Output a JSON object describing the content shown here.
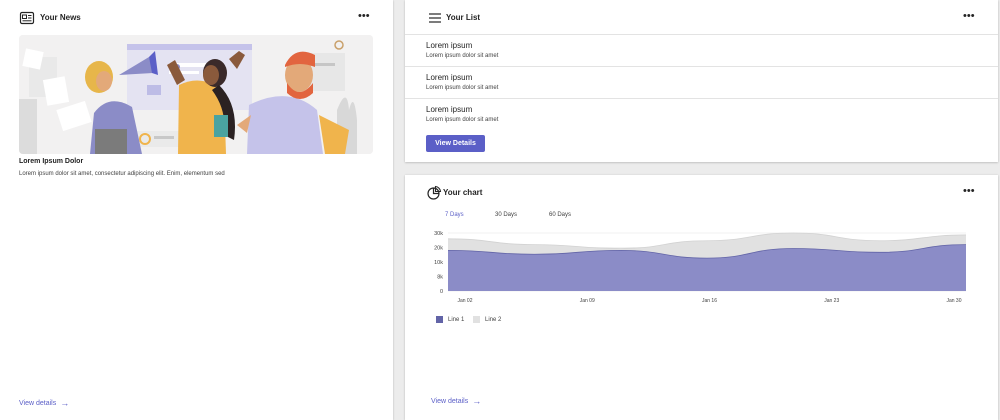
{
  "news": {
    "title": "Your News",
    "icon": "news-icon",
    "headline": "Lorem Ipsum Dolor",
    "body": "Lorem ipsum dolor sit amet, consectetur adipiscing elit. Enim, elementum sed",
    "view_details": "View details"
  },
  "list": {
    "title": "Your List",
    "icon": "menu-icon",
    "items": [
      {
        "title": "Lorem ipsum",
        "subtitle": "Lorem ipsum dolor sit amet"
      },
      {
        "title": "Lorem ipsum",
        "subtitle": "Lorem ipsum dolor sit amet"
      },
      {
        "title": "Lorem ipsum",
        "subtitle": "Lorem ipsum dolor sit amet"
      }
    ],
    "button": "View Details"
  },
  "chart": {
    "title": "Your chart",
    "icon": "pie-chart-icon",
    "tabs": [
      "7 Days",
      "30 Days",
      "60 Days"
    ],
    "active_tab": "7 Days",
    "view_details": "View details"
  },
  "colors": {
    "accent": "#5b5fc7",
    "line1": "#8b8cc7",
    "line2": "#e1e1e1"
  },
  "chart_data": {
    "type": "area",
    "x_labels": [
      "Jan 02",
      "Jan 09",
      "Jan 16",
      "Jan 23",
      "Jan 30"
    ],
    "y_ticks": [
      "30k",
      "20k",
      "10k",
      "8k",
      "0"
    ],
    "x": [
      "Jan 02",
      "Jan 09",
      "Jan 16",
      "Jan 23",
      "Jan 30"
    ],
    "series": [
      {
        "name": "Line 1",
        "values": [
          21,
          19,
          21,
          17,
          22,
          20,
          24
        ]
      },
      {
        "name": "Line 2",
        "values": [
          27,
          24,
          22,
          26,
          30,
          26,
          29
        ]
      }
    ],
    "legend_position": "bottom-left",
    "grid": true
  }
}
